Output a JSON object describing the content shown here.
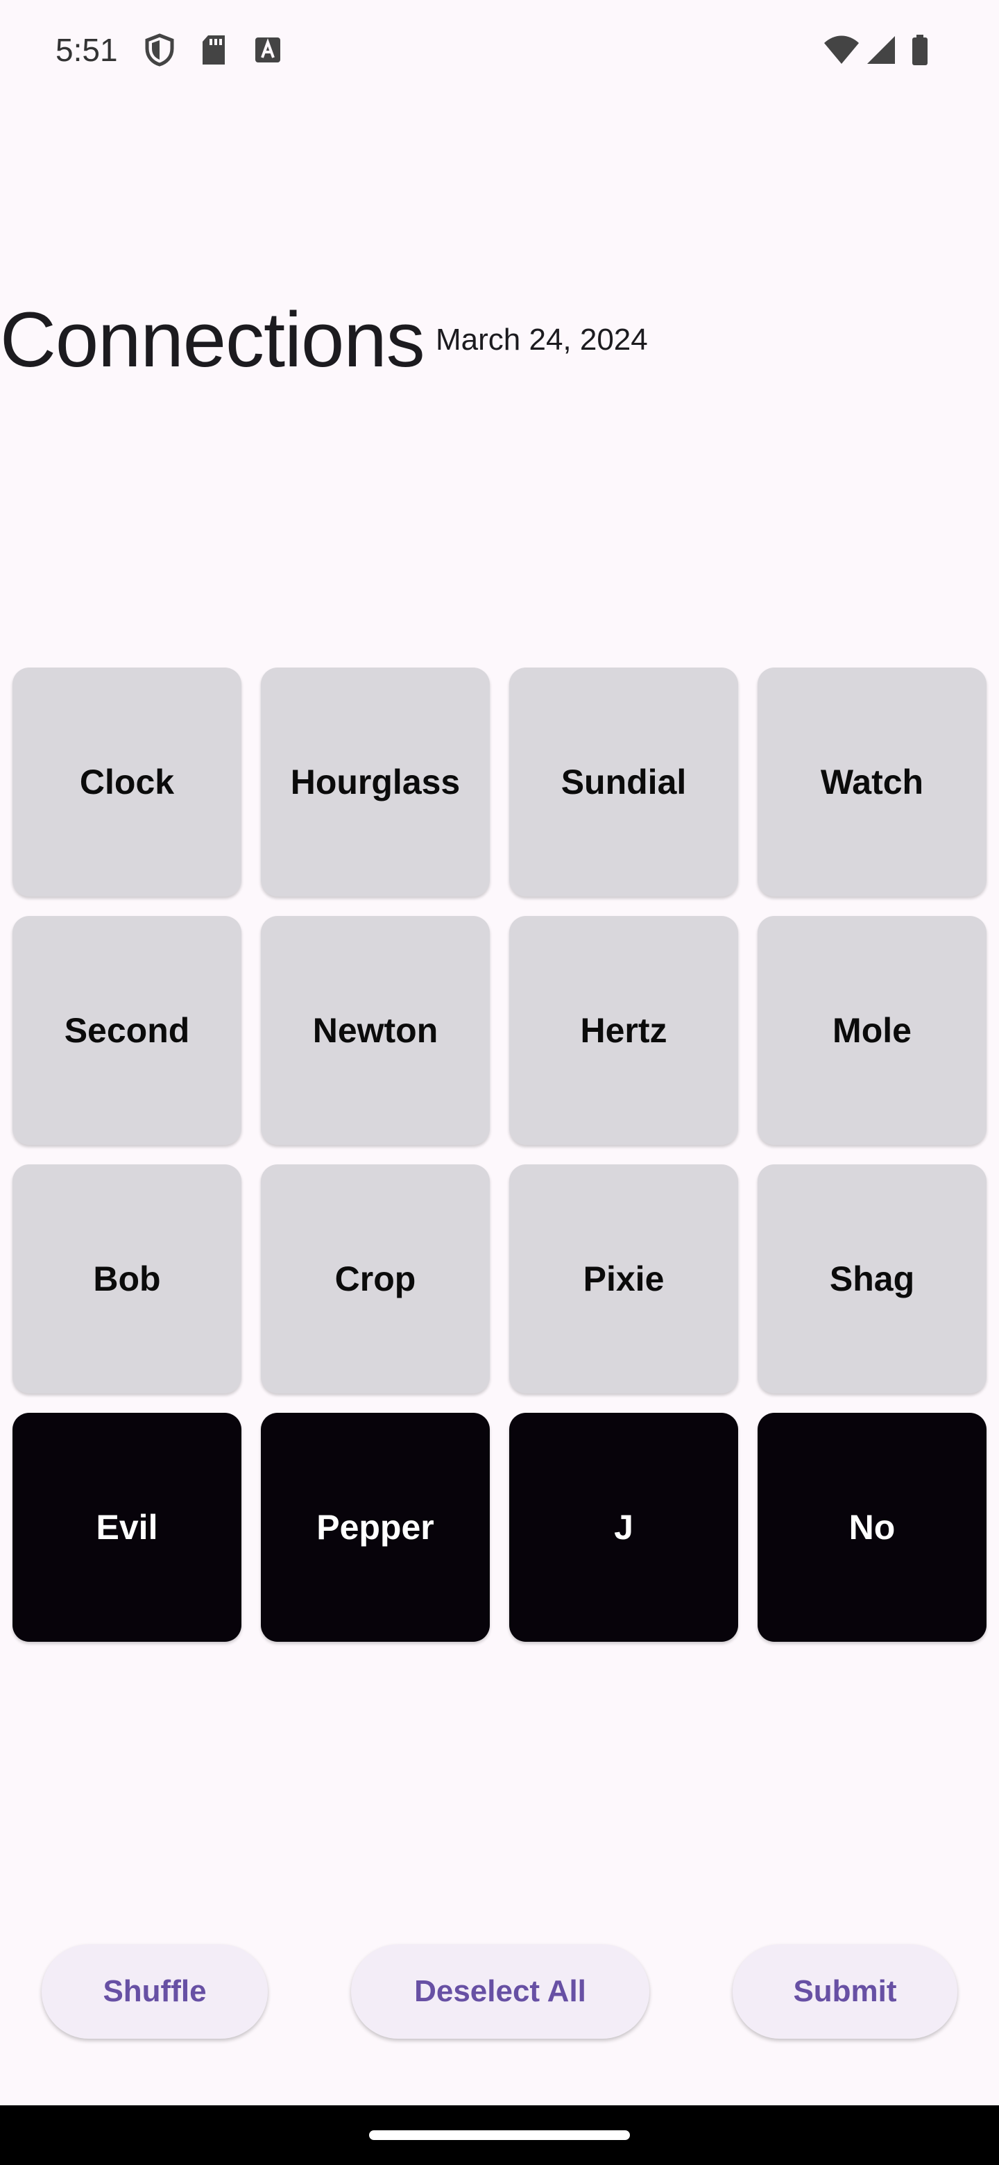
{
  "status_bar": {
    "time": "5:51",
    "icons": [
      "shield-icon",
      "sd-card-icon",
      "a-icon",
      "wifi-icon",
      "signal-icon",
      "battery-icon"
    ]
  },
  "header": {
    "title": "Connections",
    "date": "March 24, 2024"
  },
  "tiles": [
    {
      "label": "Clock",
      "selected": false
    },
    {
      "label": "Hourglass",
      "selected": false
    },
    {
      "label": "Sundial",
      "selected": false
    },
    {
      "label": "Watch",
      "selected": false
    },
    {
      "label": "Second",
      "selected": false
    },
    {
      "label": "Newton",
      "selected": false
    },
    {
      "label": "Hertz",
      "selected": false
    },
    {
      "label": "Mole",
      "selected": false
    },
    {
      "label": "Bob",
      "selected": false
    },
    {
      "label": "Crop",
      "selected": false
    },
    {
      "label": "Pixie",
      "selected": false
    },
    {
      "label": "Shag",
      "selected": false
    },
    {
      "label": "Evil",
      "selected": true
    },
    {
      "label": "Pepper",
      "selected": true
    },
    {
      "label": "J",
      "selected": true
    },
    {
      "label": "No",
      "selected": true
    }
  ],
  "actions": {
    "shuffle_label": "Shuffle",
    "deselect_label": "Deselect All",
    "submit_label": "Submit"
  },
  "colors": {
    "background": "#fdf8fc",
    "tile_default": "#d9d7dc",
    "tile_selected": "#07030a",
    "button_background": "#f3edf7",
    "button_text": "#6750a4"
  }
}
